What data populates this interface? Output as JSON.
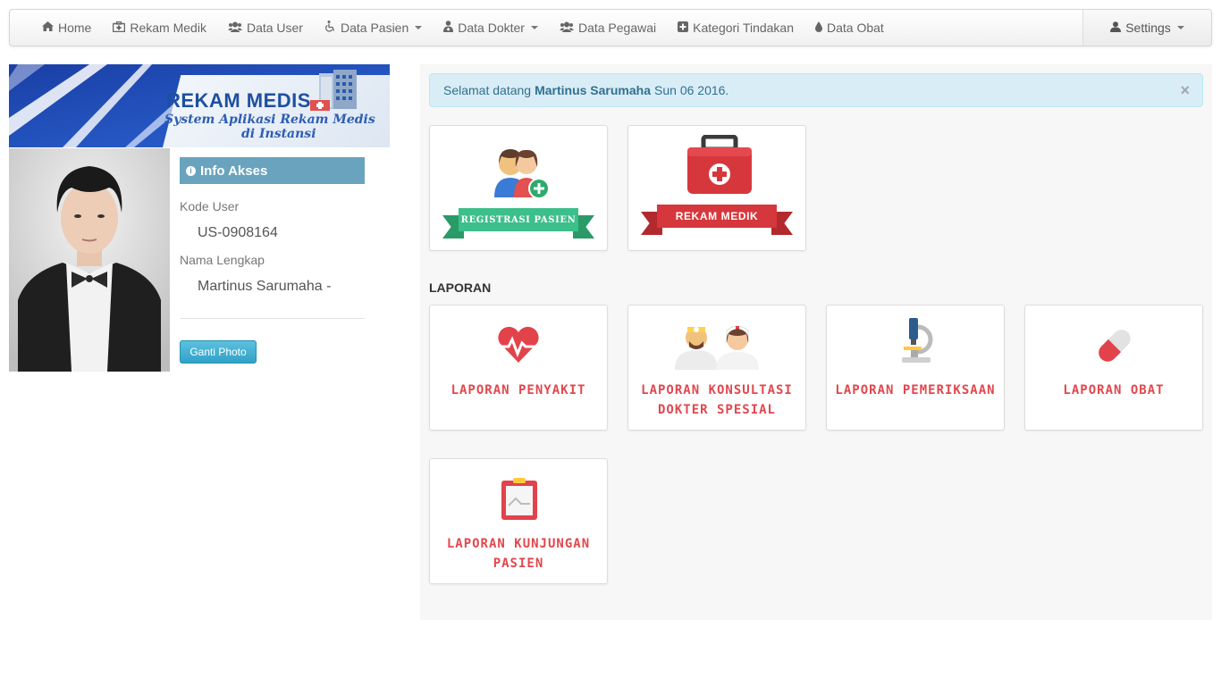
{
  "navbar": {
    "items": [
      {
        "label": "Home",
        "icon": "home-icon"
      },
      {
        "label": "Rekam Medik",
        "icon": "medkit-icon"
      },
      {
        "label": "Data User",
        "icon": "users-icon"
      },
      {
        "label": "Data Pasien",
        "icon": "wheelchair-icon",
        "dropdown": true
      },
      {
        "label": "Data Dokter",
        "icon": "user-md-icon",
        "dropdown": true
      },
      {
        "label": "Data Pegawai",
        "icon": "users-icon"
      },
      {
        "label": "Kategori Tindakan",
        "icon": "plus-square-icon"
      },
      {
        "label": "Data Obat",
        "icon": "tint-icon"
      }
    ],
    "settings_label": "Settings"
  },
  "banner": {
    "title": "REKAM MEDIS",
    "subtitle_line1": "System Aplikasi Rekam Medis",
    "subtitle_line2": "di Instansi"
  },
  "info": {
    "heading": "Info Akses",
    "kode_user_label": "Kode User",
    "kode_user_value": "US-0908164",
    "nama_label": "Nama Lengkap",
    "nama_value": "Martinus Sarumaha -",
    "change_photo_button": "Ganti Photo"
  },
  "alert": {
    "prefix": "Selamat datang",
    "name": "Martinus Sarumaha",
    "suffix": "Sun 06 2016.",
    "close": "×"
  },
  "quick": {
    "registrasi": "REGISTRASI PASIEN",
    "rekam_medik": "REKAM MEDIK"
  },
  "laporan": {
    "section_title": "LAPORAN",
    "penyakit": "LAPORAN PENYAKIT",
    "konsultasi_line1": "LAPORAN KONSULTASI",
    "konsultasi_line2": "DOKTER SPESIAL",
    "pemeriksaan": "LAPORAN PEMERIKSAAN",
    "obat": "LAPORAN OBAT",
    "kunjungan_line1": "LAPORAN KUNJUNGAN",
    "kunjungan_line2": "PASIEN"
  },
  "colors": {
    "accent_red": "#e0484e",
    "ribbon_green": "#3cbf8a",
    "ribbon_red": "#d6373c",
    "info_header": "#6aa3bd",
    "alert_bg": "#d9edf7"
  }
}
